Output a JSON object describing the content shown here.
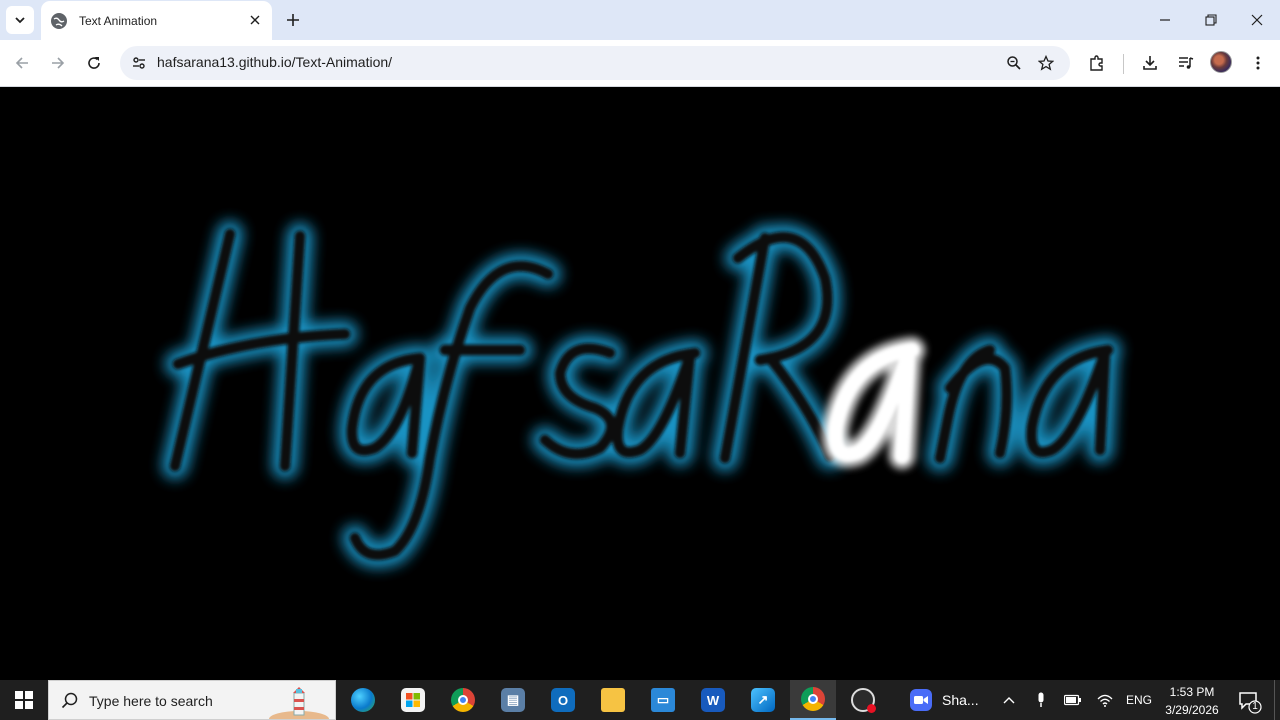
{
  "browser": {
    "tab": {
      "title": "Text Animation"
    },
    "address_bar": {
      "url": "hafsarana13.github.io/Text-Animation/"
    }
  },
  "page": {
    "heading_text": "HafsaRana",
    "background_color": "#000000",
    "glow_color": "#1aa3d9",
    "letter_color": "#111111",
    "highlight_color": "#ffffff"
  },
  "taskbar": {
    "search_placeholder": "Type here to search",
    "zoom_label": "Sha...",
    "language": "ENG",
    "time": "1:53 PM",
    "date": "3/29/2026",
    "notification_count": "1"
  }
}
